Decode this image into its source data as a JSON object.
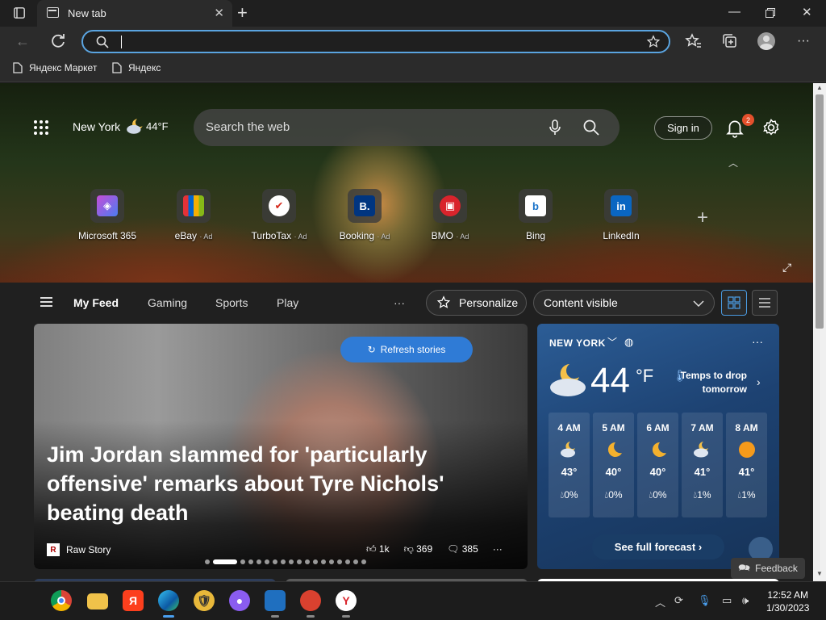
{
  "browser": {
    "tab_title": "New tab",
    "address_value": "",
    "favorites": [
      "Яндекс Маркет",
      "Яндекс"
    ]
  },
  "header": {
    "location": "New York",
    "temperature": "44°F",
    "search_placeholder": "Search the web",
    "sign_in": "Sign in",
    "notification_count": "2"
  },
  "tiles": [
    {
      "label": "Microsoft 365",
      "ad": ""
    },
    {
      "label": "eBay",
      "ad": "· Ad"
    },
    {
      "label": "TurboTax",
      "ad": "· Ad"
    },
    {
      "label": "Booking",
      "ad": "· Ad"
    },
    {
      "label": "BMO",
      "ad": "· Ad"
    },
    {
      "label": "Bing",
      "ad": ""
    },
    {
      "label": "LinkedIn",
      "ad": ""
    }
  ],
  "feed_nav": {
    "items": [
      "My Feed",
      "Gaming",
      "Sports",
      "Play"
    ],
    "more": "···",
    "personalize": "Personalize",
    "content_visible": "Content visible"
  },
  "story": {
    "refresh": "Refresh stories",
    "headline": "Jim Jordan slammed for 'particularly offensive' remarks about Tyre Nichols' beating death",
    "source": "Raw Story",
    "source_logo": "R",
    "likes": "1k",
    "dislikes": "369",
    "comments": "385",
    "more": "···"
  },
  "weather": {
    "city": "NEW YORK",
    "temp": "44",
    "unit": "°F",
    "alert": "Temps to drop tomorrow",
    "more": "···",
    "hours": [
      {
        "time": "4 AM",
        "temp": "43°",
        "precip": "0%",
        "icon": "partly-cloudy-night"
      },
      {
        "time": "5 AM",
        "temp": "40°",
        "precip": "0%",
        "icon": "moon"
      },
      {
        "time": "6 AM",
        "temp": "40°",
        "precip": "0%",
        "icon": "moon"
      },
      {
        "time": "7 AM",
        "temp": "41°",
        "precip": "1%",
        "icon": "partly-cloudy-night"
      },
      {
        "time": "8 AM",
        "temp": "41°",
        "precip": "1%",
        "icon": "sun"
      }
    ],
    "forecast_btn": "See full forecast"
  },
  "feedback": "Feedback",
  "taskbar": {
    "time": "12:52 AM",
    "date": "1/30/2023"
  }
}
